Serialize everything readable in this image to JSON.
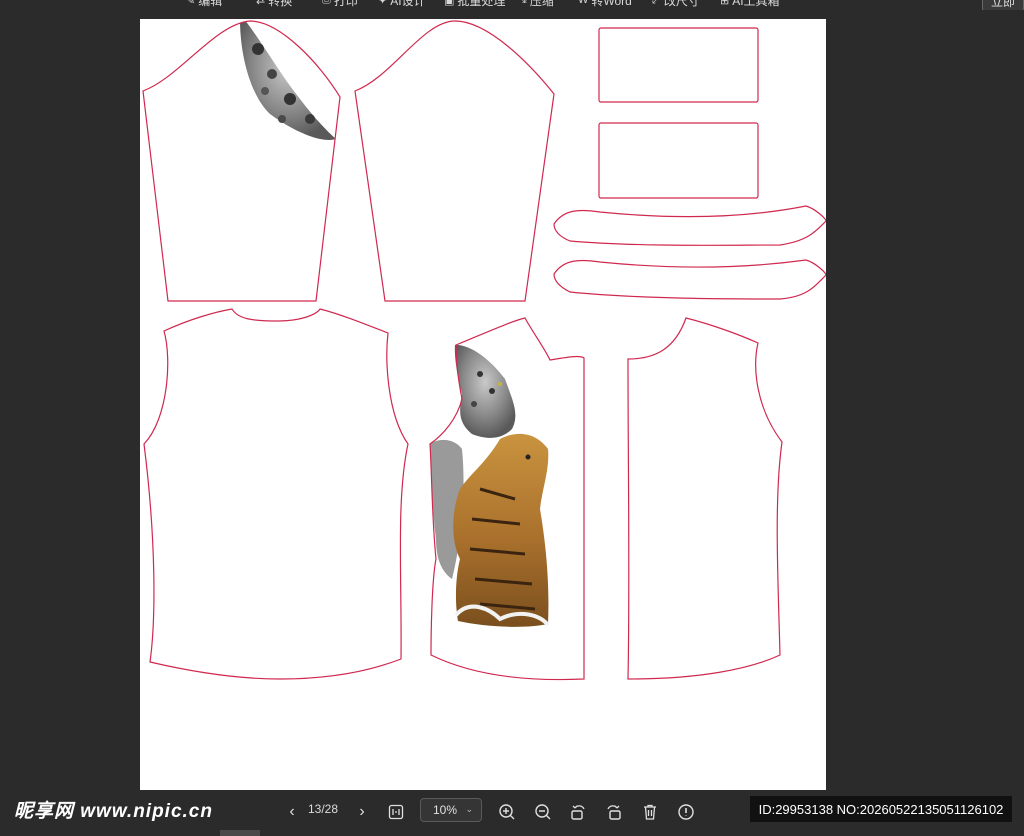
{
  "toolbar": {
    "items": [
      {
        "label": "编辑",
        "icon": "edit-icon"
      },
      {
        "label": "转换",
        "icon": "convert-icon"
      },
      {
        "label": "打印",
        "icon": "print-icon"
      },
      {
        "label": "AI设计",
        "icon": "ai-design-icon"
      },
      {
        "label": "批量处理",
        "icon": "batch-icon"
      },
      {
        "label": "压缩",
        "icon": "compress-icon"
      },
      {
        "label": "转Word",
        "icon": "word-icon"
      },
      {
        "label": "改尺寸",
        "icon": "resize-icon"
      },
      {
        "label": "AI工具箱",
        "icon": "ai-toolbox-icon"
      }
    ],
    "right_button": "立即"
  },
  "viewer": {
    "page_indicator": "13/28",
    "zoom": "10%",
    "outline_color": "#d0294f",
    "page_color": "#ffffff",
    "background_color": "#2b2b2b"
  },
  "bottom_tools": [
    {
      "name": "prev-page",
      "icon": "chevron-left-icon"
    },
    {
      "name": "next-page",
      "icon": "chevron-right-icon"
    },
    {
      "name": "fit-page",
      "icon": "fit-page-icon"
    },
    {
      "name": "zoom-in",
      "icon": "zoom-in-icon"
    },
    {
      "name": "zoom-out",
      "icon": "zoom-out-icon"
    },
    {
      "name": "rotate-left",
      "icon": "rotate-left-icon"
    },
    {
      "name": "rotate-right",
      "icon": "rotate-right-icon"
    },
    {
      "name": "delete",
      "icon": "trash-icon"
    },
    {
      "name": "info",
      "icon": "info-icon"
    }
  ],
  "watermark": {
    "logo": "昵享网 www.nipic.cn",
    "id_text": "ID:29953138 NO:20260522135051126102"
  }
}
